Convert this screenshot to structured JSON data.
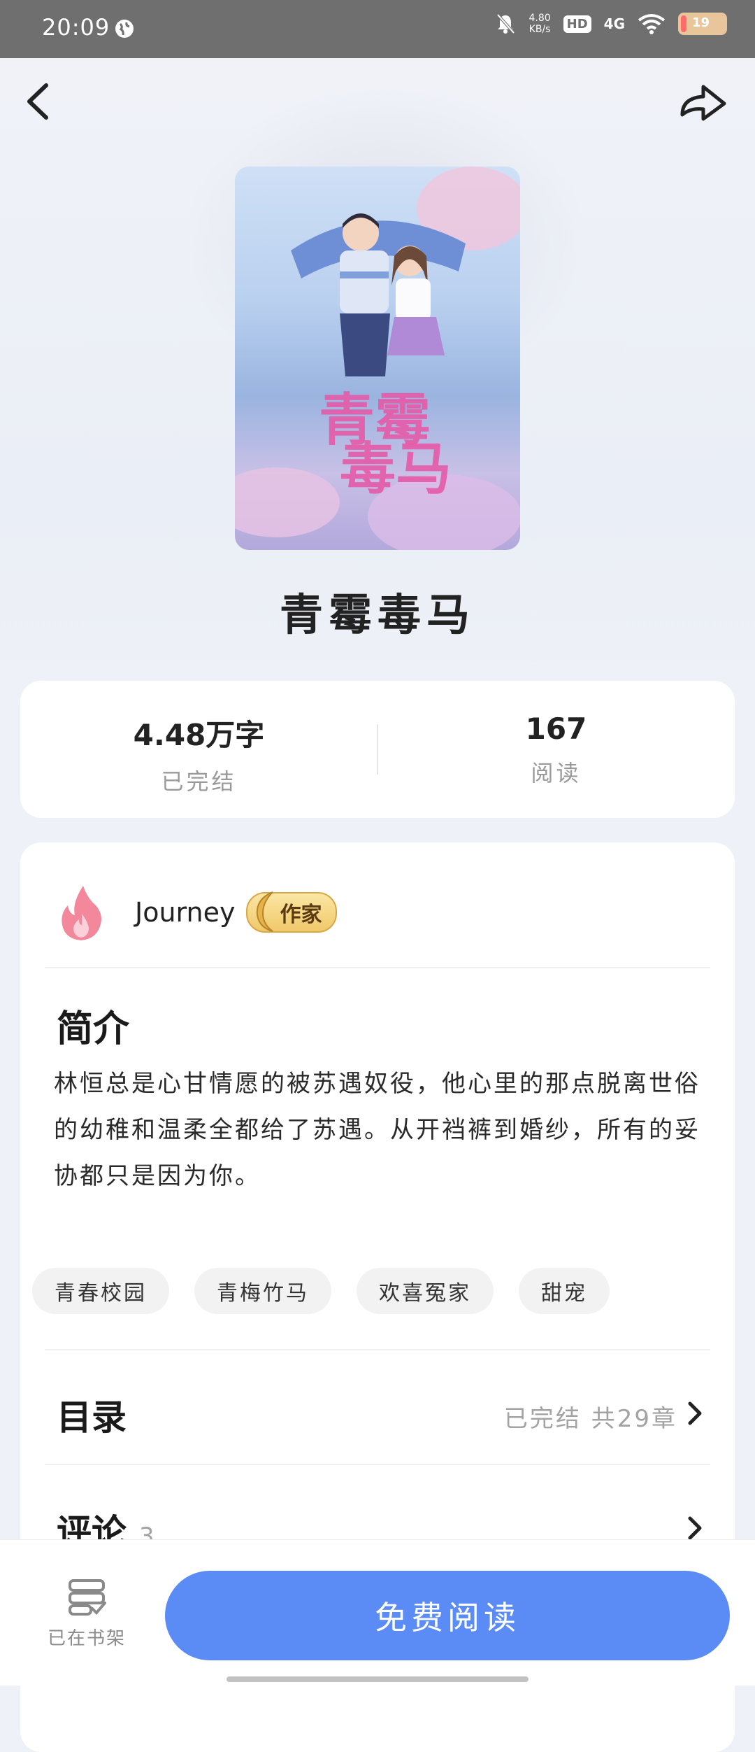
{
  "status_bar": {
    "time": "20:09",
    "net_speed_value": "4.80",
    "net_speed_unit": "KB/s",
    "hd_label": "HD",
    "network_label": "4G",
    "battery_level": "19"
  },
  "book": {
    "title": "青霉毒马",
    "word_count": "4.48万字",
    "status": "已完结",
    "reads": "167",
    "reads_label": "阅读"
  },
  "author": {
    "name": "Journey",
    "badge": "作家"
  },
  "intro": {
    "title": "简介",
    "text": "林恒总是心甘情愿的被苏遇奴役，他心里的那点脱离世俗的幼稚和温柔全都给了苏遇。从开裆裤到婚纱，所有的妥协都只是因为你。"
  },
  "tags": [
    "青春校园",
    "青梅竹马",
    "欢喜冤家",
    "甜宠"
  ],
  "catalog": {
    "title": "目录",
    "meta": "已完结 共29章"
  },
  "comments": {
    "title": "评论",
    "count": "3"
  },
  "bottom_bar": {
    "shelf_label": "已在书架",
    "read_button": "免费阅读"
  },
  "colors": {
    "primary_button": "#5b8cf5",
    "badge_gold": "#f0c86a",
    "flame_pink": "#f3879c"
  }
}
